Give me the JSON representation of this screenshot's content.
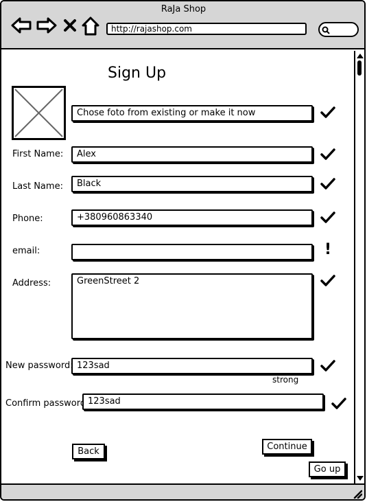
{
  "browser": {
    "title": "RaJa Shop",
    "url": "http://rajashop.com",
    "icons": [
      "back-arrow-icon",
      "forward-arrow-icon",
      "close-icon",
      "home-icon",
      "search-icon"
    ]
  },
  "form": {
    "title": "Sign Up",
    "photo_prompt": "Chose foto from existing or make it now",
    "first_name": {
      "label": "First Name:",
      "value": "Alex",
      "status": "ok"
    },
    "last_name": {
      "label": "Last Name:",
      "value": "Black",
      "status": "ok"
    },
    "phone": {
      "label": "Phone:",
      "value": "+380960863340",
      "status": "ok"
    },
    "email": {
      "label": "email:",
      "value": "",
      "status": "warning"
    },
    "address": {
      "label": "Address:",
      "value": "GreenStreet 2",
      "status": "ok"
    },
    "new_password": {
      "label": "New password:",
      "value": "123sad",
      "strength": "strong",
      "status": "ok"
    },
    "confirm_password": {
      "label": "Confirm password:",
      "value": "123sad",
      "status": "ok"
    },
    "warning_mark": "!"
  },
  "buttons": {
    "back": "Back",
    "continue": "Continue",
    "go_up": "Go up"
  }
}
